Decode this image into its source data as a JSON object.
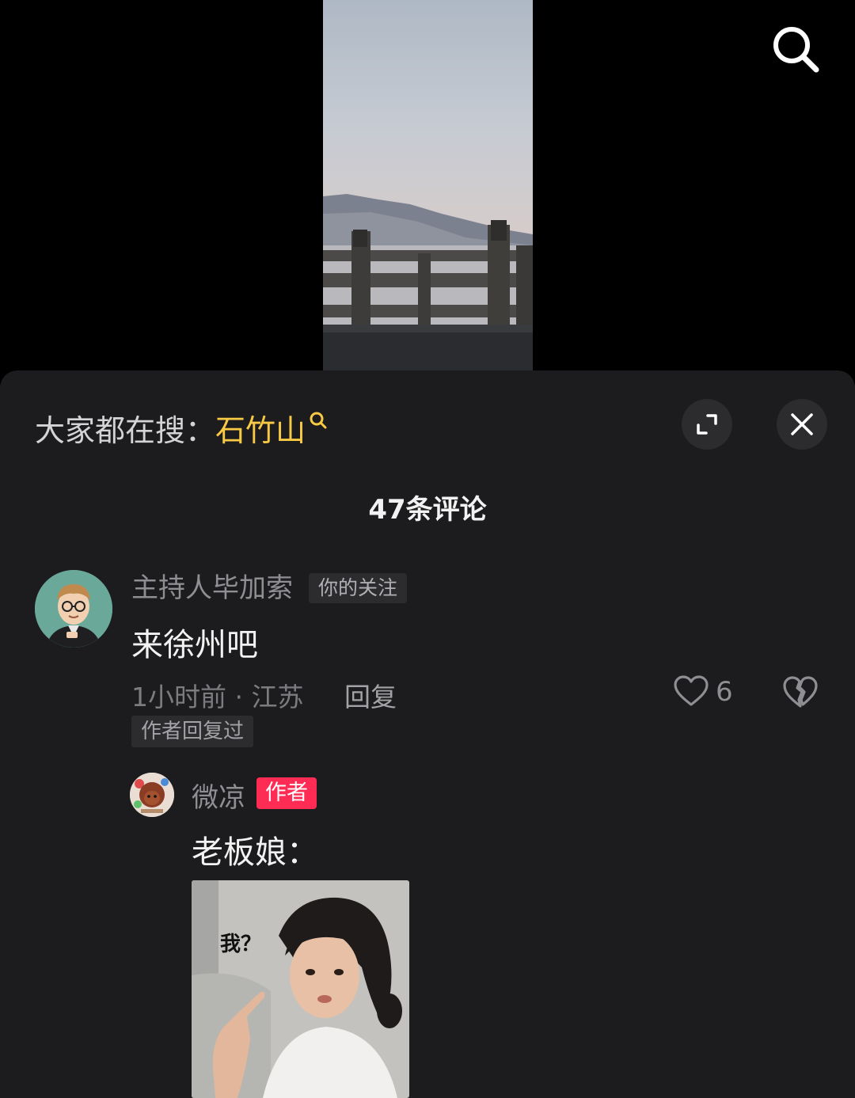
{
  "icons": {
    "top_search": "search-icon",
    "trend_search": "search-small-icon",
    "expand": "expand-icon",
    "close": "close-icon",
    "like": "heart-icon",
    "dislike": "broken-heart-icon"
  },
  "colors": {
    "sheet_bg": "#1c1c1e",
    "keyword": "#f7c945",
    "author_tag": "#fe2c55"
  },
  "trend": {
    "prefix": "大家都在搜：",
    "keyword": "石竹山"
  },
  "comments_count": "47条评论",
  "comment": {
    "username": "主持人毕加索",
    "follow_tag": "你的关注",
    "text": "来徐州吧",
    "meta": "1小时前 · 江苏",
    "reply_label": "回复",
    "like_count": "6",
    "author_replied_tag": "作者回复过"
  },
  "reply": {
    "username": "微凉",
    "author_tag": "作者",
    "text": "老板娘：",
    "sticker_caption": "我？"
  }
}
